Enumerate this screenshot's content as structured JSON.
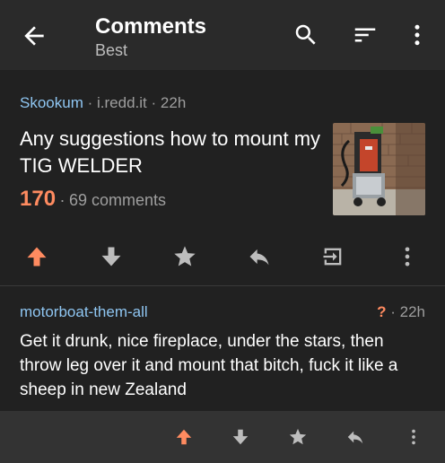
{
  "header": {
    "title": "Comments",
    "subtitle": "Best",
    "icons": [
      "back-arrow-icon",
      "search-icon",
      "sort-icon",
      "more-vertical-icon"
    ]
  },
  "post": {
    "subreddit": "Skookum",
    "domain": "i.redd.it",
    "age": "22h",
    "separator": "·",
    "title": "Any suggestions how to mount my TIG WELDER",
    "score": "170",
    "comments": "69 comments",
    "thumbnail": "photo of a TIG welder on a cart beside a brick wall",
    "actions": [
      "upvote-icon",
      "downvote-icon",
      "star-icon",
      "reply-icon",
      "open-link-icon",
      "more-vertical-icon"
    ]
  },
  "comment": {
    "author": "motorboat-them-all",
    "score_hidden": "?",
    "age": "22h",
    "separator": "·",
    "body": "Get it drunk, nice fireplace, under the stars, then throw leg over it and mount that bitch, fuck it like a sheep in new Zealand",
    "actions": [
      "upvote-icon",
      "downvote-icon",
      "star-icon",
      "reply-icon",
      "more-vertical-icon"
    ]
  },
  "colors": {
    "accent_orange": "#ff8b60",
    "link_blue": "#8fc6f2",
    "background": "#212121",
    "toolbar": "#2a2a2a",
    "comment_bar": "#333333",
    "icon_gray": "#bdbdbd"
  }
}
